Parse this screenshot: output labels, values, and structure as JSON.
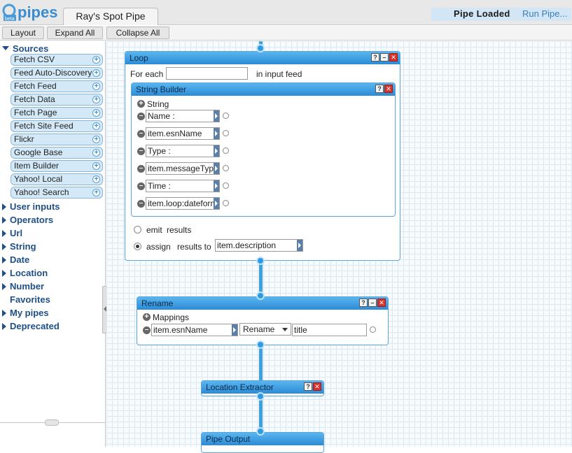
{
  "app": {
    "logo_text": "pipes",
    "logo_badge": "beta",
    "tab_title": "Ray's Spot Pipe",
    "status": "Pipe Loaded",
    "run_pipe": "Run Pipe..."
  },
  "toolbar": {
    "layout": "Layout",
    "expand_all": "Expand All",
    "collapse_all": "Collapse All"
  },
  "sidebar": {
    "sources_label": "Sources",
    "sources": [
      "Fetch CSV",
      "Feed Auto-Discovery",
      "Fetch Feed",
      "Fetch Data",
      "Fetch Page",
      "Fetch Site Feed",
      "Flickr",
      "Google Base",
      "Item Builder",
      "Yahoo! Local",
      "Yahoo! Search"
    ],
    "categories": [
      "User inputs",
      "Operators",
      "Url",
      "String",
      "Date",
      "Location",
      "Number",
      "Favorites",
      "My pipes",
      "Deprecated"
    ]
  },
  "loop": {
    "title": "Loop",
    "for_each": "For each",
    "in_input_feed": "in input feed",
    "for_each_value": "",
    "emit": "emit",
    "emit_results": "results",
    "assign": "assign",
    "results_to": "results to",
    "assign_target": "item.description",
    "assign_selected": true
  },
  "string_builder": {
    "title": "String Builder",
    "add_label": "String",
    "fields": [
      "Name :",
      "item.esnName",
      "Type :",
      "item.messageType",
      "Time :",
      "item.loop:dateformat"
    ]
  },
  "rename": {
    "title": "Rename",
    "add_label": "Mappings",
    "source": "item.esnName",
    "operation": "Rename",
    "target": "title"
  },
  "location_extractor": {
    "title": "Location Extractor"
  },
  "pipe_output": {
    "title": "Pipe Output"
  },
  "colors": {
    "accent": "#2f9ae0",
    "header": "#3a9be3",
    "category": "#1e4f86",
    "close": "#d8332b"
  }
}
